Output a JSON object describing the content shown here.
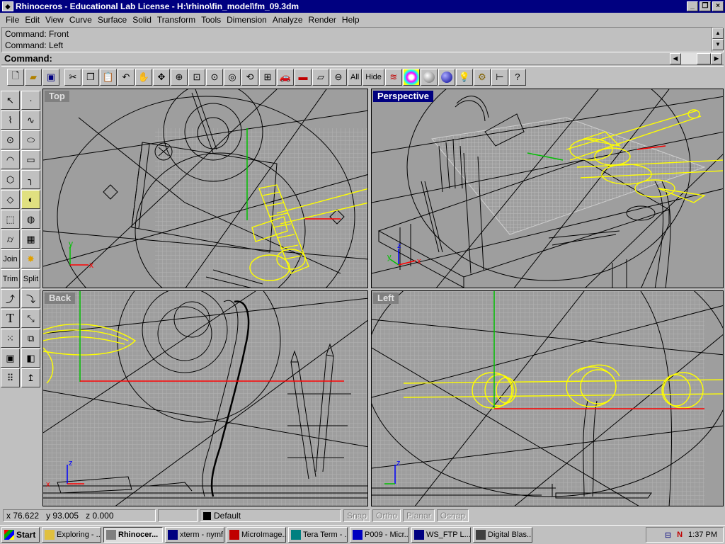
{
  "window": {
    "title": "Rhinoceros - Educational Lab License - H:\\rhino\\fin_model\\fm_09.3dm"
  },
  "menu": [
    "File",
    "Edit",
    "View",
    "Curve",
    "Surface",
    "Solid",
    "Transform",
    "Tools",
    "Dimension",
    "Analyze",
    "Render",
    "Help"
  ],
  "command_history": [
    "Command: Front",
    "Command: Left"
  ],
  "command_prompt": "Command:",
  "toolbar": {
    "all_label": "All",
    "hide_label": "Hide"
  },
  "left_tools": {
    "join": "Join",
    "trim": "Trim",
    "split": "Split",
    "text_tool": "T"
  },
  "viewports": {
    "top": {
      "title": "Top"
    },
    "perspective": {
      "title": "Perspective"
    },
    "back": {
      "title": "Back"
    },
    "left": {
      "title": "Left"
    }
  },
  "axis_labels": {
    "x": "x",
    "y": "y",
    "z": "z"
  },
  "status": {
    "x_label": "x",
    "x": "76.622",
    "y_label": "y",
    "y": "93.005",
    "z_label": "z",
    "z": "0.000",
    "layer": "Default",
    "snap": "Snap",
    "ortho": "Ortho",
    "planar": "Planar",
    "osnap": "Osnap"
  },
  "taskbar": {
    "start": "Start",
    "tasks": [
      "Exploring - ...",
      "Rhinocer...",
      "xterm - nymf...",
      "MicroImage...",
      "Tera Term - ...",
      "P009 - Micr...",
      "WS_FTP L...",
      "Digital Blas..."
    ],
    "clock": "1:37 PM"
  },
  "colors": {
    "wire": "#000000",
    "selected": "#ffff00",
    "x_axis": "#ff0000",
    "y_axis": "#00c000",
    "grid": "#b4b4b4",
    "viewport_bg": "#9e9e9e"
  }
}
